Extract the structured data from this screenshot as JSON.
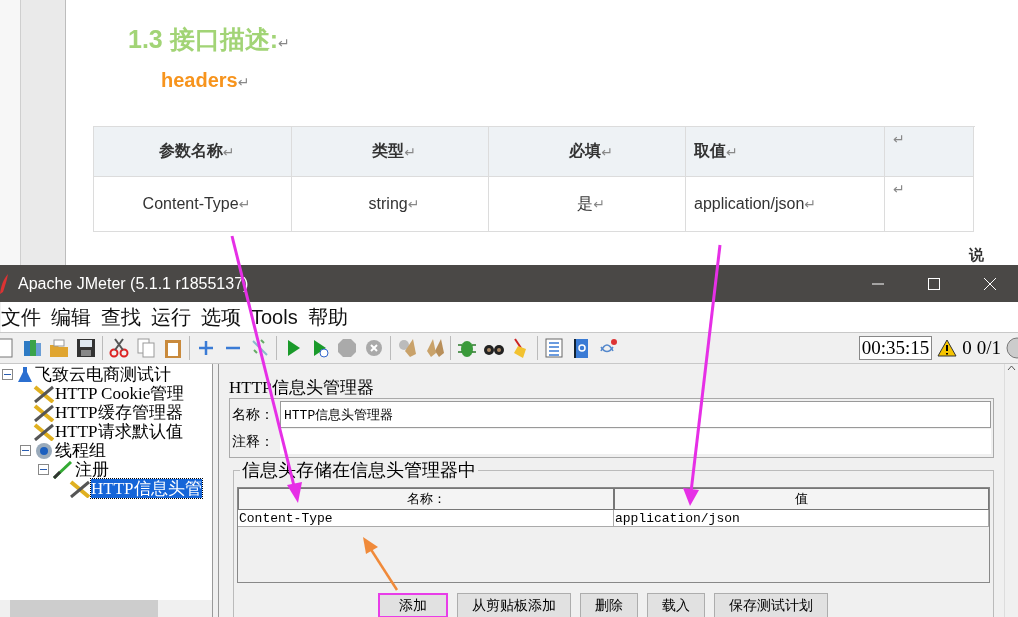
{
  "document": {
    "heading": {
      "text": "1.3 接口描述:",
      "mark": "↵"
    },
    "subheading": {
      "text": "headers",
      "mark": "↵"
    },
    "table": {
      "columns": [
        {
          "text": "参数名称",
          "mark": "↵"
        },
        {
          "text": "类型",
          "mark": "↵"
        },
        {
          "text": "必填",
          "mark": "↵"
        },
        {
          "text": "取值",
          "mark": "↵"
        },
        {
          "text": "",
          "mark": "↵"
        }
      ],
      "rows": [
        [
          {
            "text": "Content-Type",
            "mark": "↵"
          },
          {
            "text": "string",
            "mark": "↵"
          },
          {
            "text": "是",
            "mark": "↵"
          },
          {
            "text": "application/json",
            "mark": "↵"
          },
          {
            "text": "",
            "mark": "↵"
          }
        ]
      ]
    },
    "side_note": "说"
  },
  "window": {
    "title": "Apache JMeter (5.1.1 r1855137)"
  },
  "menu": [
    "文件",
    "编辑",
    "查找",
    "运行",
    "选项",
    "Tools",
    "帮助"
  ],
  "toolbar": {
    "timer": "00:35:15",
    "warnings": "0",
    "threads": "0/1"
  },
  "tree": [
    {
      "label": "飞致云电商测试计",
      "kind": "plan",
      "selected": false,
      "expanded": true,
      "children": [
        {
          "label": "HTTP Cookie管理",
          "kind": "config",
          "selected": false
        },
        {
          "label": "HTTP缓存管理器",
          "kind": "config",
          "selected": false
        },
        {
          "label": "HTTP请求默认值",
          "kind": "config",
          "selected": false
        },
        {
          "label": "线程组",
          "kind": "threads",
          "selected": false,
          "expanded": true,
          "children": [
            {
              "label": "注册",
              "kind": "sampler",
              "selected": false,
              "expanded": true,
              "children": [
                {
                  "label": "HTTP信息头管",
                  "kind": "config",
                  "selected": true
                }
              ]
            }
          ]
        }
      ]
    }
  ],
  "editor": {
    "title": "HTTP信息头管理器",
    "name_label": "名称：",
    "name_value": "HTTP信息头管理器",
    "comment_label": "注释：",
    "group_title": "信息头存储在信息头管理器中",
    "columns": [
      "名称：",
      "值"
    ],
    "rows": [
      [
        "Content-Type",
        "application/json"
      ]
    ],
    "buttons": [
      {
        "label": "添加",
        "highlighted": true
      },
      {
        "label": "从剪贴板添加",
        "highlighted": false
      },
      {
        "label": "删除",
        "highlighted": false
      },
      {
        "label": "载入",
        "highlighted": false
      },
      {
        "label": "保存测试计划",
        "highlighted": false
      }
    ]
  }
}
